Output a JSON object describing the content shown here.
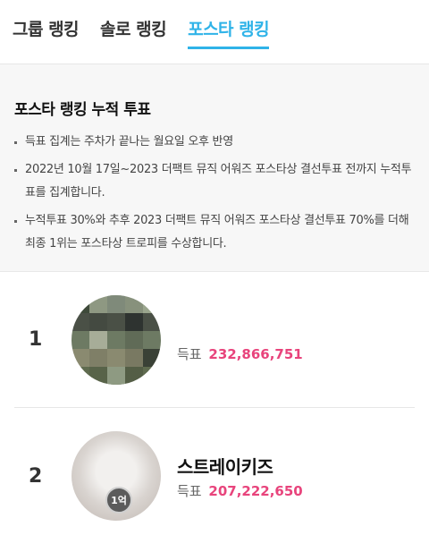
{
  "tabs": [
    {
      "label": "그룹 랭킹",
      "active": false
    },
    {
      "label": "솔로 랭킹",
      "active": false
    },
    {
      "label": "포스타 랭킹",
      "active": true
    }
  ],
  "notice": {
    "title": "포스타 랭킹 누적 투표",
    "items": [
      "득표 집계는 주차가 끝나는 월요일 오후 반영",
      "2022년 10월 17일~2023 더팩트 뮤직 어워즈 포스타상 결선투표 전까지 누적투표를 집계합니다.",
      "누적투표 30%와 추후 2023 더팩트 뮤직 어워즈 포스타상 결선투표 70%를 더해 최종 1위는 포스타상 트로피를 수상합니다."
    ]
  },
  "ranking": [
    {
      "rank": "1",
      "name": "",
      "votes_label": "득표",
      "votes": "232,866,751"
    },
    {
      "rank": "2",
      "name": "스트레이키즈",
      "votes_label": "득표",
      "votes": "207,222,650",
      "badge": "1억"
    }
  ],
  "colors": {
    "accent": "#2fb3e8",
    "votes": "#e8447c"
  }
}
